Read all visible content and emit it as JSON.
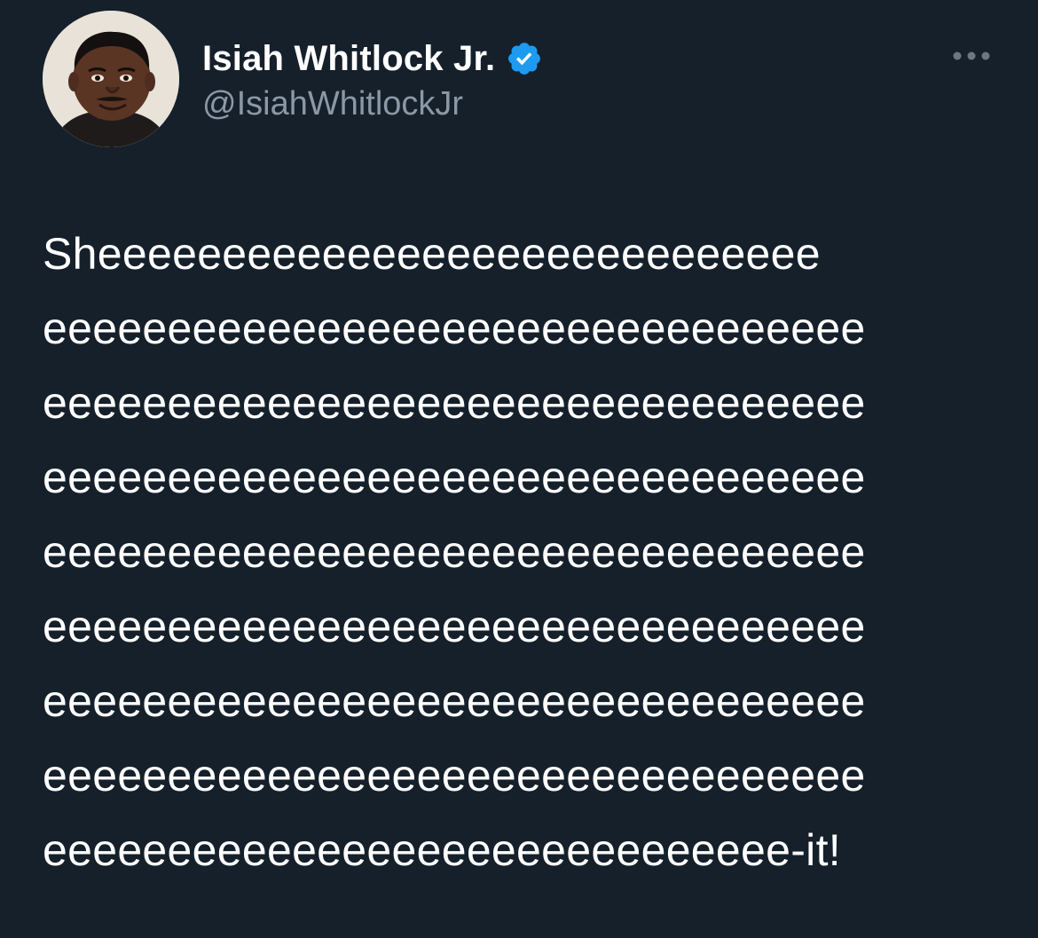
{
  "author": {
    "display_name": "Isiah Whitlock Jr.",
    "handle": "@IsiahWhitlockJr",
    "verified": true
  },
  "colors": {
    "background": "#15202b",
    "text": "#ffffff",
    "secondary_text": "#8b98a5",
    "verified_badge": "#1d9bf0"
  },
  "icons": {
    "verified": "verified-badge-icon",
    "more": "more-options-icon"
  },
  "tweet": {
    "lines": [
      "Sheeeeeeeeeeeeeeeeeeeeeeeeeeeee",
      "eeeeeeeeeeeeeeeeeeeeeeeeeeeeeeeee",
      "eeeeeeeeeeeeeeeeeeeeeeeeeeeeeeeee",
      "eeeeeeeeeeeeeeeeeeeeeeeeeeeeeeeee",
      "eeeeeeeeeeeeeeeeeeeeeeeeeeeeeeeee",
      "eeeeeeeeeeeeeeeeeeeeeeeeeeeeeeeee",
      "eeeeeeeeeeeeeeeeeeeeeeeeeeeeeeeee",
      "eeeeeeeeeeeeeeeeeeeeeeeeeeeeeeeee",
      "eeeeeeeeeeeeeeeeeeeeeeeeeeeeee-it!"
    ]
  }
}
